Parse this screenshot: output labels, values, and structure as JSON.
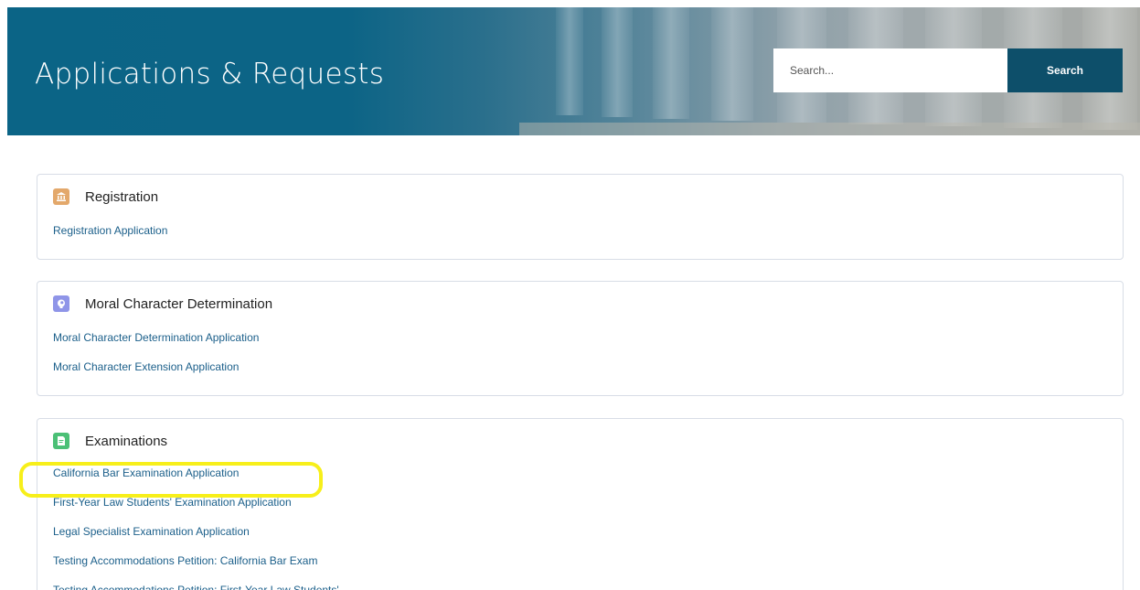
{
  "header": {
    "title": "Applications & Requests",
    "search": {
      "placeholder": "Search...",
      "button_label": "Search"
    }
  },
  "sections": [
    {
      "title": "Registration",
      "icon": "building-icon",
      "icon_color": "#e3a86b",
      "links": [
        "Registration Application"
      ]
    },
    {
      "title": "Moral Character Determination",
      "icon": "head-icon",
      "icon_color": "#8f95e8",
      "links": [
        "Moral Character Determination Application",
        "Moral Character Extension Application"
      ]
    },
    {
      "title": "Examinations",
      "icon": "document-icon",
      "icon_color": "#4bc076",
      "links": [
        "California Bar Examination Application",
        "First-Year Law Students' Examination Application",
        "Legal Specialist Examination Application",
        "Testing Accommodations Petition: California Bar Exam",
        "Testing Accommodations Petition: First-Year Law Students' ..."
      ]
    }
  ],
  "highlight_color": "#f7ef1a"
}
